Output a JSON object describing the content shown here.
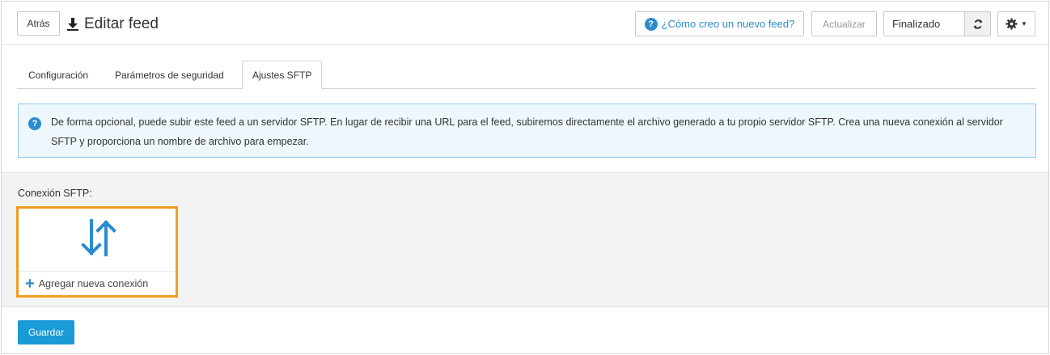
{
  "header": {
    "back_label": "Atrás",
    "title": "Editar feed",
    "help_label": "¿Cómo creo un nuevo feed?",
    "update_label": "Actualizar",
    "status_value": "Finalizado"
  },
  "tabs": [
    {
      "label": "Configuración",
      "active": false
    },
    {
      "label": "Parámetros de seguridad",
      "active": false
    },
    {
      "label": "Ajustes SFTP",
      "active": true
    }
  ],
  "info": {
    "text": "De forma opcional, puede subir este feed a un servidor SFTP. En lugar de recibir una URL para el feed, subiremos directamente el archivo generado a tu propio servidor SFTP. Crea una nueva conexión al servidor SFTP y proporciona un nombre de archivo para empezar."
  },
  "sftp": {
    "label": "Conexión SFTP:",
    "add_connection_label": "Agregar nueva conexión"
  },
  "footer": {
    "save_label": "Guardar"
  },
  "icons": {
    "download": "download-icon",
    "help": "question-circle-icon",
    "refresh": "refresh-icon",
    "gear": "gear-icon",
    "transfer": "up-down-arrows-icon",
    "plus": "plus-icon"
  },
  "colors": {
    "accent": "#2a8ccf",
    "save_button": "#1a9ad6",
    "highlight_border": "#f29c1f",
    "info_bg": "#eef7fc",
    "info_border": "#8ccbe9"
  }
}
